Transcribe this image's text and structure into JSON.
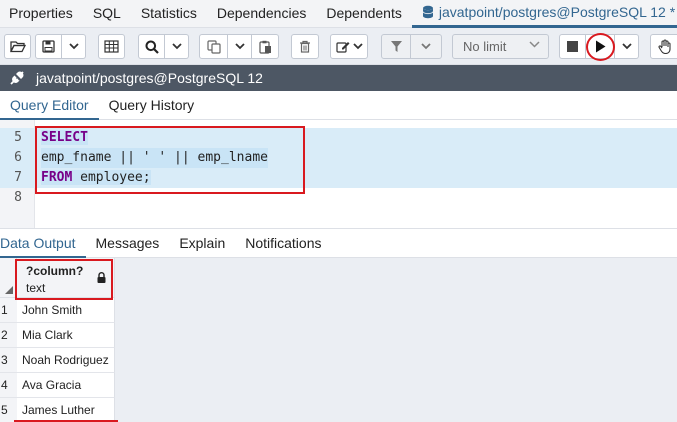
{
  "tabs": [
    {
      "label": "Properties"
    },
    {
      "label": "SQL"
    },
    {
      "label": "Statistics"
    },
    {
      "label": "Dependencies"
    },
    {
      "label": "Dependents"
    }
  ],
  "active_tab": {
    "label": "javatpoint/postgres@PostgreSQL 12 *",
    "icon": "database-icon"
  },
  "toolbar": {
    "limit_value": "No limit",
    "icons": [
      "folder-open-icon",
      "save-icon",
      "chevron-down-icon",
      "table-icon",
      "search-icon",
      "copy-icon",
      "paste-icon",
      "trash-icon",
      "edit-icon",
      "filter-icon",
      "stop-icon",
      "play-icon",
      "hand-icon"
    ]
  },
  "connection": {
    "label": "javatpoint/postgres@PostgreSQL 12",
    "icon": "plug-icon"
  },
  "editor_tabs": [
    {
      "label": "Query Editor"
    },
    {
      "label": "Query History"
    }
  ],
  "editor": {
    "lines": [
      {
        "num": "5",
        "kw": "SELECT",
        "rest": ""
      },
      {
        "num": "6",
        "kw": "",
        "rest": "emp_fname || ' ' || emp_lname"
      },
      {
        "num": "7",
        "kw": "FROM",
        "rest": " employee;"
      },
      {
        "num": "8",
        "kw": "",
        "rest": ""
      }
    ]
  },
  "result_tabs": [
    {
      "label": "Data Output"
    },
    {
      "label": "Messages"
    },
    {
      "label": "Explain"
    },
    {
      "label": "Notifications"
    }
  ],
  "grid": {
    "column": {
      "name": "?column?",
      "type": "text"
    },
    "rows": [
      {
        "num": "1",
        "value": "John Smith"
      },
      {
        "num": "2",
        "value": "Mia Clark"
      },
      {
        "num": "3",
        "value": "Noah Rodriguez"
      },
      {
        "num": "4",
        "value": "Ava Gracia"
      },
      {
        "num": "5",
        "value": "James Luther"
      }
    ]
  },
  "colors": {
    "accent": "#326690",
    "highlight_red": "#d9191f",
    "connection_bar": "#4d5764",
    "keyword": "#770088"
  }
}
